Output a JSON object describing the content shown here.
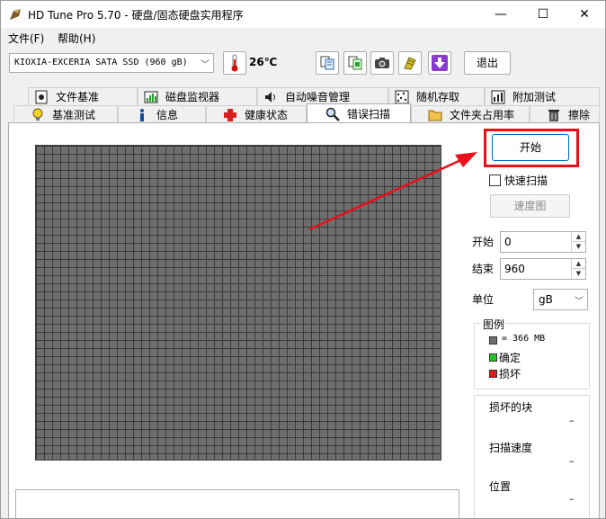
{
  "window": {
    "title": "HD Tune Pro 5.70 - 硬盘/固态硬盘实用程序",
    "minimize": "—",
    "maximize": "☐",
    "close": "✕"
  },
  "menu": {
    "items": [
      {
        "label": "文件(F)"
      },
      {
        "label": "帮助(H)"
      }
    ]
  },
  "toolbar": {
    "drive_value": "KIOXIA-EXCERIA SATA SSD (960 gB)",
    "temperature": "26℃",
    "exit_label": "退出",
    "icons": [
      "copy-info-icon",
      "copy-screenshot-icon",
      "camera-icon",
      "options-icon",
      "download-icon"
    ]
  },
  "tabs": {
    "row1": [
      {
        "label": "文件基准",
        "icon": "file-benchmark-icon"
      },
      {
        "label": "磁盘监视器",
        "icon": "disk-monitor-icon"
      },
      {
        "label": "自动噪音管理",
        "icon": "speaker-icon"
      },
      {
        "label": "随机存取",
        "icon": "random-access-icon"
      },
      {
        "label": "附加测试",
        "icon": "extra-tests-icon"
      }
    ],
    "row2": [
      {
        "label": "基准测试",
        "icon": "lightbulb-icon"
      },
      {
        "label": "信息",
        "icon": "info-icon"
      },
      {
        "label": "健康状态",
        "icon": "health-cross-icon"
      },
      {
        "label": "错误扫描",
        "icon": "magnifier-icon",
        "active": true
      },
      {
        "label": "文件夹占用率",
        "icon": "folder-icon"
      },
      {
        "label": "擦除",
        "icon": "trash-icon"
      }
    ]
  },
  "scan": {
    "start_label": "开始",
    "quick_scan_label": "快速扫描",
    "quick_scan_checked": false,
    "speed_map_label": "速度图",
    "start_field_label": "开始",
    "start_value": "0",
    "end_field_label": "结束",
    "end_value": "960",
    "unit_label": "单位",
    "unit_value": "gB"
  },
  "legend": {
    "title": "图例",
    "block_size": "= 366 MB",
    "ok_label": "确定",
    "damaged_label": "损坏",
    "colors": {
      "block": "#6e6e6e",
      "ok": "#1ec81e",
      "damaged": "#dc1e1e"
    }
  },
  "stats": {
    "damaged_blocks_label": "损坏的块",
    "damaged_blocks_value": "–",
    "scan_speed_label": "扫描速度",
    "scan_speed_value": "–",
    "position_label": "位置",
    "position_value": "–"
  },
  "colors": {
    "accent": "#0067c0",
    "highlight": "#e8101a"
  }
}
